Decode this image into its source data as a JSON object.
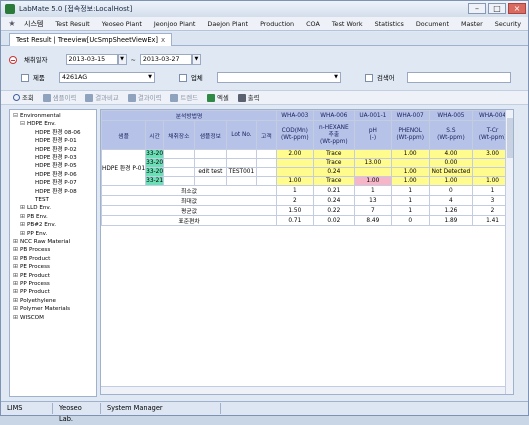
{
  "window": {
    "title": "LabMate 5.0 [접속정보:LocalHost]"
  },
  "menu": {
    "items": [
      "시스템",
      "Test Result",
      "Yeoseo Plant",
      "Jeonjoo Plant",
      "Daejon Plant",
      "Production",
      "COA",
      "Test Work",
      "Statistics",
      "Document",
      "Master",
      "Security"
    ]
  },
  "tab": {
    "label": "Test Result | Treeview[UcSmpSheetViewEx]",
    "close": "x"
  },
  "filter": {
    "date_label": "채취일자",
    "date_from": "2013-03-15",
    "date_sep": "~",
    "date_to": "2013-03-27",
    "product_label": "제품",
    "product_value": "4261AG",
    "company_label": "업체",
    "company_value": "",
    "inspector_label": "검색어",
    "inspector_value": ""
  },
  "toolbar": {
    "search": "조회",
    "sample_history": "샘플이력",
    "result_compare": "결과비교",
    "result_history": "결과이력",
    "trend": "트렌드",
    "excel": "엑셀",
    "print": "출력"
  },
  "tree": [
    {
      "label": "Environmental",
      "state": "exp",
      "indent": 0
    },
    {
      "label": "HDPE Env.",
      "state": "exp",
      "indent": 1
    },
    {
      "label": "HDPE 환경 08-06",
      "state": "",
      "indent": 2
    },
    {
      "label": "HDPE 환경 P-01",
      "state": "",
      "indent": 2
    },
    {
      "label": "HDPE 환경 P-02",
      "state": "",
      "indent": 2
    },
    {
      "label": "HDPE 환경 P-03",
      "state": "",
      "indent": 2
    },
    {
      "label": "HDPE 환경 P-05",
      "state": "",
      "indent": 2
    },
    {
      "label": "HDPE 환경 P-06",
      "state": "",
      "indent": 2
    },
    {
      "label": "HDPE 환경 P-07",
      "state": "",
      "indent": 2
    },
    {
      "label": "HDPE 환경 P-08",
      "state": "",
      "indent": 2
    },
    {
      "label": "TEST",
      "state": "",
      "indent": 2
    },
    {
      "label": "LLD Env.",
      "state": "col",
      "indent": 1
    },
    {
      "label": "PB Env.",
      "state": "col",
      "indent": 1
    },
    {
      "label": "PB#2 Env.",
      "state": "col",
      "indent": 1
    },
    {
      "label": "PP Env.",
      "state": "col",
      "indent": 1
    },
    {
      "label": "NCC Raw Material",
      "state": "col",
      "indent": 0
    },
    {
      "label": "PB Process",
      "state": "col",
      "indent": 0
    },
    {
      "label": "PB Product",
      "state": "col",
      "indent": 0
    },
    {
      "label": "PE Process",
      "state": "col",
      "indent": 0
    },
    {
      "label": "PE Product",
      "state": "col",
      "indent": 0
    },
    {
      "label": "PP Process",
      "state": "col",
      "indent": 0
    },
    {
      "label": "PP Product",
      "state": "col",
      "indent": 0
    },
    {
      "label": "Polyethylene",
      "state": "col",
      "indent": 0
    },
    {
      "label": "Polymer Materials",
      "state": "col",
      "indent": 0
    },
    {
      "label": "WISCOM",
      "state": "col",
      "indent": 0
    }
  ],
  "grid": {
    "group_header": "분석방법명",
    "left_headers": [
      "샘플",
      "시간",
      "채취장소",
      "샘플정보",
      "Lot No.",
      "고객"
    ],
    "method_codes": [
      "WHA-003",
      "WHA-006",
      "UA-001-1",
      "WHA-007",
      "WHA-005",
      "WHA-004"
    ],
    "method_names": [
      "COD(Mn)\n(Wt-ppm)",
      "n-HEXANE\n추출\n(Wt-ppm)",
      "pH\n(-)",
      "PHENOL\n(Wt-ppm)",
      "S.S\n(Wt-ppm)",
      "T-Cr\n(Wt-ppm)"
    ],
    "sample_name": "HDPE 환경 P-01",
    "rows": [
      {
        "time": "33-20",
        "info": "",
        "lot": "",
        "cust": "",
        "vals": [
          "2.00",
          "Trace",
          "",
          "1.00",
          "4.00",
          "3.00"
        ],
        "cls": [
          "y",
          "y",
          "y",
          "y",
          "y",
          "y"
        ]
      },
      {
        "time": "33-20",
        "info": "",
        "lot": "",
        "cust": "",
        "vals": [
          "",
          "Trace",
          "13.00",
          "",
          "0.00",
          ""
        ],
        "cls": [
          "y",
          "y",
          "y",
          "y",
          "y",
          "y"
        ]
      },
      {
        "time": "33-20",
        "info": "edit test",
        "lot": "TEST001",
        "cust": "",
        "vals": [
          "",
          "0.24",
          "",
          "1.00",
          "Not Detected",
          ""
        ],
        "cls": [
          "y",
          "y",
          "y",
          "y",
          "y",
          "y"
        ]
      },
      {
        "time": "33-21",
        "info": "",
        "lot": "",
        "cust": "",
        "vals": [
          "1.00",
          "Trace",
          "1.00",
          "1.00",
          "1.00",
          "1.00"
        ],
        "cls": [
          "y",
          "y",
          "pk",
          "y",
          "y",
          "y"
        ]
      }
    ],
    "stats": [
      {
        "label": "최소값",
        "vals": [
          "1",
          "0.21",
          "1",
          "1",
          "0",
          "1"
        ]
      },
      {
        "label": "최대값",
        "vals": [
          "2",
          "0.24",
          "13",
          "1",
          "4",
          "3"
        ]
      },
      {
        "label": "평균값",
        "vals": [
          "1.50",
          "0.22",
          "7",
          "1",
          "1.26",
          "2"
        ]
      },
      {
        "label": "표준편차",
        "vals": [
          "0.71",
          "0.02",
          "8.49",
          "0",
          "1.89",
          "1.41"
        ]
      }
    ]
  },
  "status": {
    "app": "LIMS",
    "company": "Yeoseo Lab.",
    "user": "System Manager"
  }
}
